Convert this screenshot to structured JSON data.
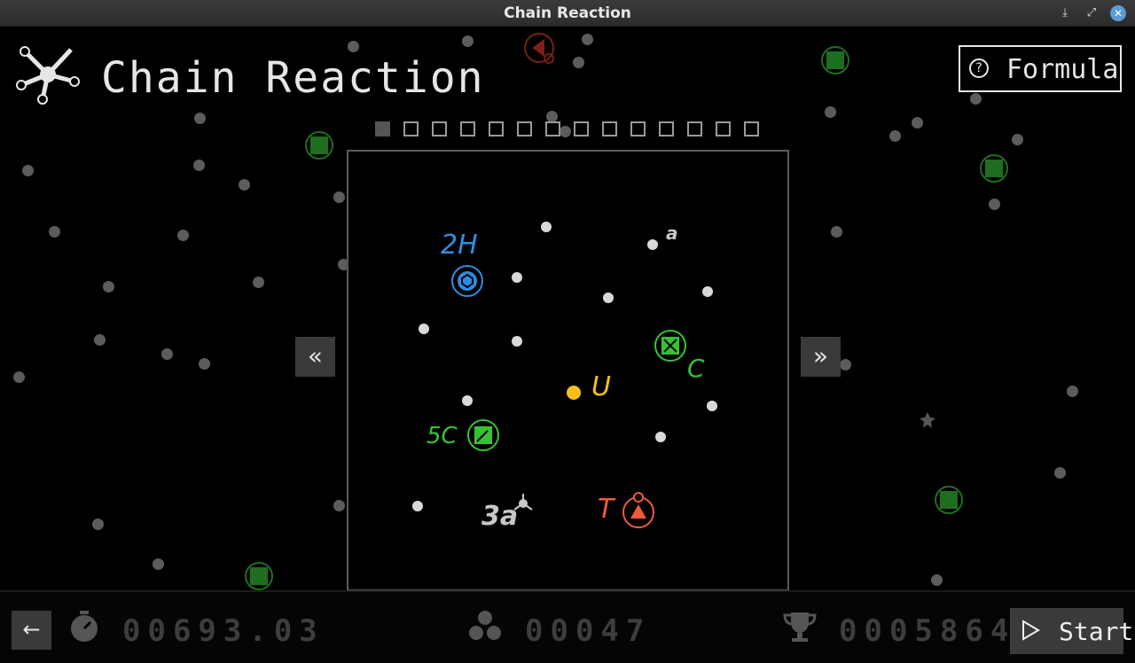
{
  "window": {
    "title": "Chain Reaction"
  },
  "titlebar_buttons": [
    "download-icon",
    "maximize-icon",
    "close-icon"
  ],
  "header": {
    "app_title": "Chain Reaction",
    "formula_label": "Formula"
  },
  "levels": {
    "count": 14,
    "current": 1
  },
  "board_labels": {
    "h": "2H",
    "a": "a",
    "c": "C",
    "u": "U",
    "fivec": "5C",
    "threea": "3a",
    "t": "T"
  },
  "colors": {
    "background": "#000000",
    "hydrogen": "#2f8de0",
    "carbon": "#36c236",
    "uranium": "#f5c01a",
    "tritium": "#f05a3c",
    "alpha": "#c8c8c8",
    "dim_carbon": "#1f6e1f"
  },
  "footer": {
    "time": "00693.03",
    "molecules": "00047",
    "score": "0005864",
    "start_label": "Start"
  }
}
